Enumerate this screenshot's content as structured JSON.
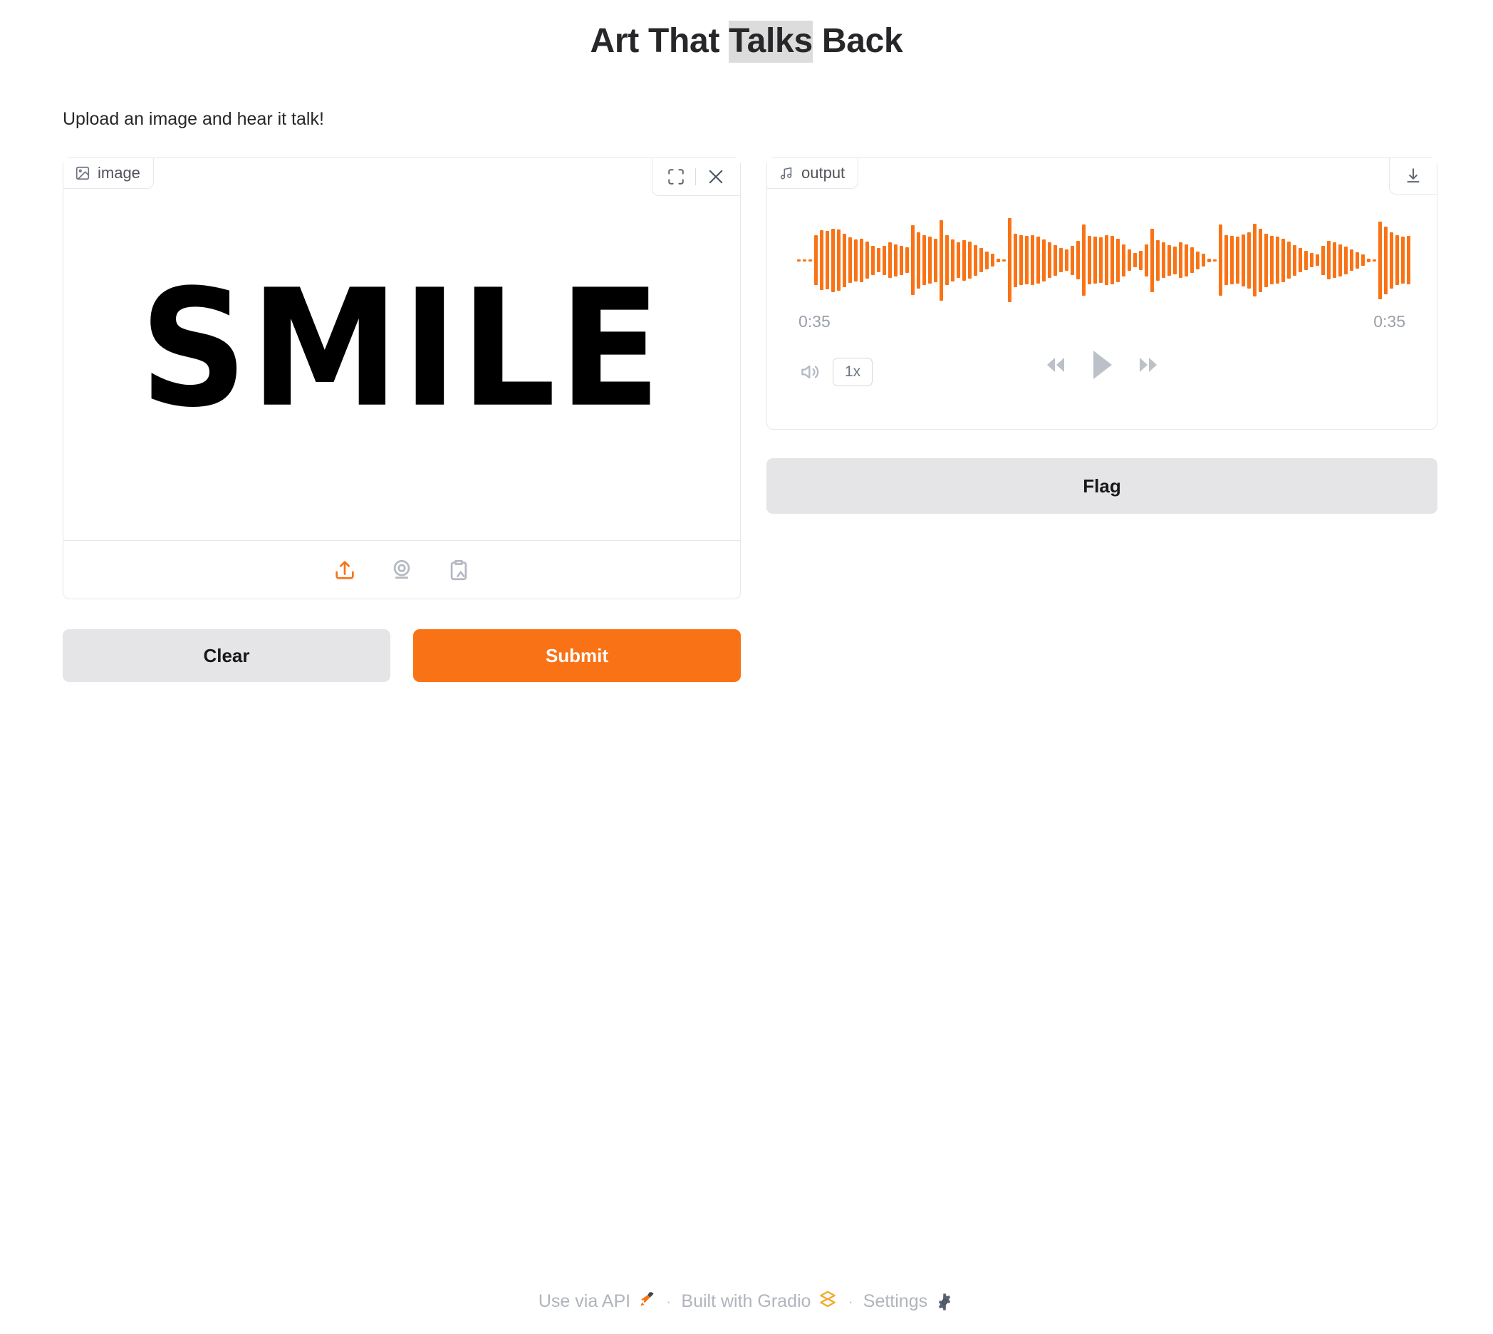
{
  "header": {
    "title_parts": [
      {
        "text": "Art That ",
        "selected": false
      },
      {
        "text": "Talks",
        "selected": true
      },
      {
        "text": " Back",
        "selected": false
      }
    ],
    "title_plain": "Art That Talks Back"
  },
  "description": "Upload an image and hear it talk!",
  "image_panel": {
    "label": "image",
    "label_icon": "image-icon",
    "fullscreen_icon": "fullscreen-icon",
    "close_icon": "close-icon",
    "artwork_text": "SMILE",
    "toolbar": [
      {
        "name": "upload-icon",
        "label": "Upload file",
        "accent": true
      },
      {
        "name": "webcam-icon",
        "label": "Take photo",
        "accent": false
      },
      {
        "name": "clipboard-image-icon",
        "label": "Paste from clipboard",
        "accent": false
      }
    ]
  },
  "actions": {
    "clear_label": "Clear",
    "submit_label": "Submit"
  },
  "audio_panel": {
    "label": "output",
    "label_icon": "music-note-icon",
    "download_icon": "download-icon",
    "current_time": "0:35",
    "total_time": "0:35",
    "volume_icon": "volume-icon",
    "speed_label": "1x",
    "rewind_icon": "rewind-icon",
    "play_icon": "play-icon",
    "forward_icon": "fast-forward-icon",
    "waveform_color": "#f97316",
    "waveform_amplitudes": [
      2,
      2,
      2,
      62,
      74,
      72,
      78,
      76,
      66,
      56,
      52,
      54,
      46,
      36,
      30,
      36,
      44,
      40,
      36,
      32,
      86,
      70,
      62,
      58,
      54,
      100,
      62,
      52,
      44,
      50,
      46,
      38,
      30,
      22,
      16,
      4,
      3,
      104,
      66,
      62,
      60,
      62,
      58,
      52,
      44,
      38,
      30,
      26,
      36,
      48,
      88,
      60,
      58,
      56,
      62,
      60,
      54,
      40,
      26,
      18,
      24,
      40,
      78,
      50,
      44,
      38,
      34,
      44,
      40,
      32,
      22,
      16,
      4,
      3,
      88,
      62,
      60,
      58,
      64,
      70,
      90,
      78,
      66,
      60,
      58,
      54,
      46,
      38,
      30,
      24,
      18,
      14,
      36,
      48,
      44,
      40,
      34,
      26,
      20,
      14,
      4,
      3,
      96,
      84,
      70,
      62,
      58,
      60,
      56,
      50,
      42,
      60,
      52,
      40,
      32,
      24
    ]
  },
  "flag": {
    "label": "Flag"
  },
  "footer": {
    "api_label": "Use via API",
    "api_emoji": "rocket-icon",
    "separator": "·",
    "gradio_label": "Built with Gradio",
    "gradio_icon": "gradio-logo-icon",
    "settings_label": "Settings",
    "settings_icon": "gear-icon"
  },
  "colors": {
    "accent": "#f97316",
    "neutral_button": "#e5e5e8",
    "border": "#e5e7eb",
    "muted_text": "#b0b4bc"
  }
}
